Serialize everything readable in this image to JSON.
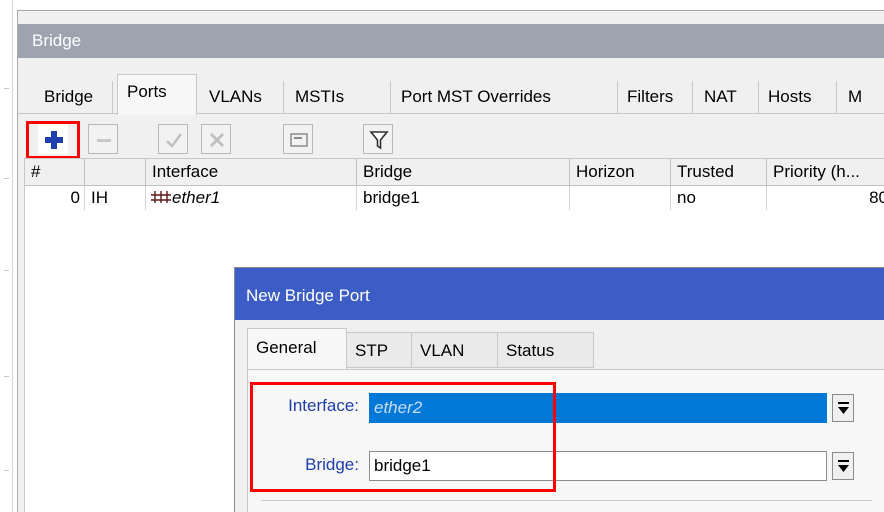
{
  "window": {
    "title": "Bridge"
  },
  "tabs": [
    "Bridge",
    "Ports",
    "VLANs",
    "MSTIs",
    "Port MST Overrides",
    "Filters",
    "NAT",
    "Hosts",
    "M"
  ],
  "active_tab": "Ports",
  "toolbar": {
    "add": "plus-icon",
    "remove": "minus-icon",
    "enable": "check-icon",
    "disable": "cross-icon",
    "comment": "comment-icon",
    "filter": "filter-icon"
  },
  "table": {
    "columns": [
      "#",
      "",
      "Interface",
      "Bridge",
      "Horizon",
      "Trusted",
      "Priority (h..."
    ],
    "rows": [
      {
        "num": "0",
        "flags": "IH",
        "interface": "ether1",
        "bridge": "bridge1",
        "horizon": "",
        "trusted": "no",
        "priority": "80"
      }
    ]
  },
  "dialog": {
    "title": "New Bridge Port",
    "tabs": [
      "General",
      "STP",
      "VLAN",
      "Status"
    ],
    "active_tab": "General",
    "fields": {
      "interface_label": "Interface:",
      "interface_value": "ether2",
      "bridge_label": "Bridge:",
      "bridge_value": "bridge1"
    }
  },
  "colors": {
    "highlight": "#ff0000",
    "selection": "#0078d7",
    "dialog_title": "#3b5dc5",
    "label": "#1e3ea8"
  }
}
